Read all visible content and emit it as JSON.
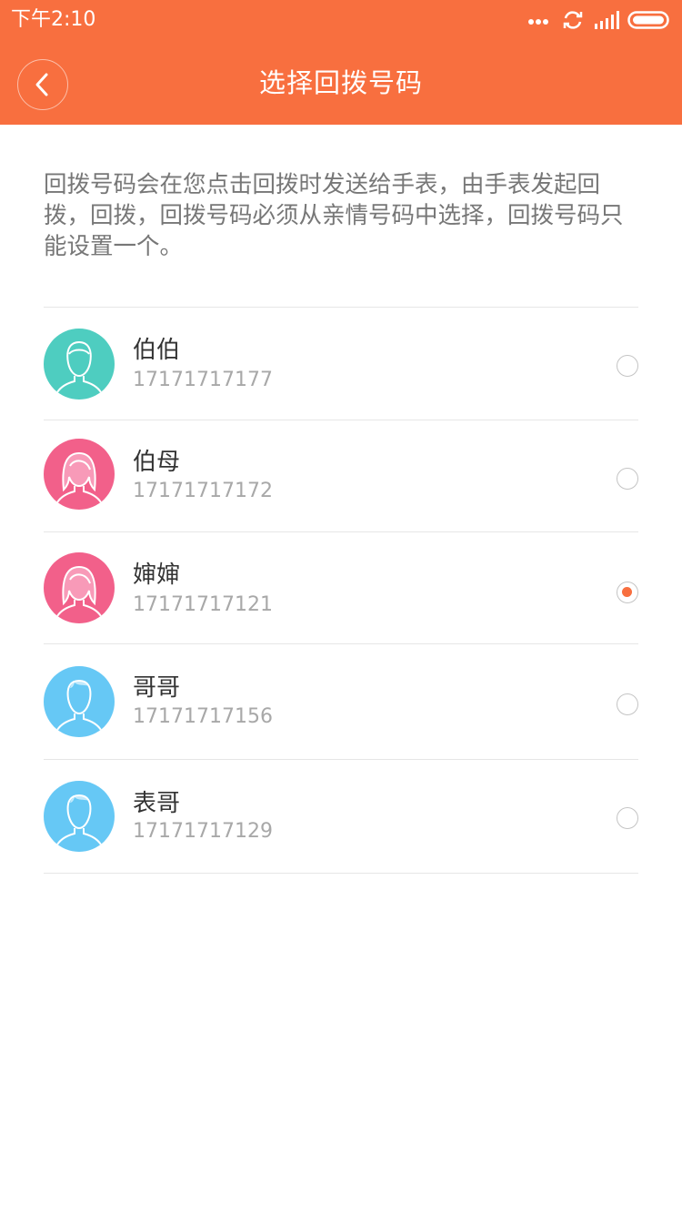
{
  "status_bar": {
    "time": "下午2:10",
    "icons": [
      "more-dots-icon",
      "sync-icon",
      "signal-icon",
      "battery-icon"
    ]
  },
  "header": {
    "title": "选择回拨号码",
    "back_icon": "chevron-left-icon",
    "background_color": "#f86f3f"
  },
  "description": "回拨号码会在您点击回拨时发送给手表，由手表发起回拨，回拨，回拨号码必须从亲情号码中选择，回拨号码只能设置一个。",
  "contacts": [
    {
      "name": "伯伯",
      "phone": "17171717177",
      "avatar": "male-avatar-icon",
      "avatar_color": "#4ecdc0",
      "selected": false
    },
    {
      "name": "伯母",
      "phone": "17171717172",
      "avatar": "female-avatar-icon",
      "avatar_color": "#f2608a",
      "selected": false
    },
    {
      "name": "婶婶",
      "phone": "17171717121",
      "avatar": "female-avatar-icon",
      "avatar_color": "#f2608a",
      "selected": true
    },
    {
      "name": "哥哥",
      "phone": "17171717156",
      "avatar": "boy-avatar-icon",
      "avatar_color": "#66c8f5",
      "selected": false
    },
    {
      "name": "表哥",
      "phone": "17171717129",
      "avatar": "boy-avatar-icon",
      "avatar_color": "#66c8f5",
      "selected": false
    }
  ],
  "accent_color": "#f86f3f"
}
